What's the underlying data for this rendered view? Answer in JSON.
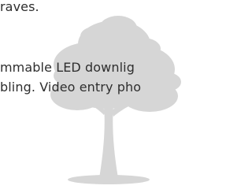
{
  "text": {
    "line_1": "raves.",
    "line_2": "mmable LED downlig",
    "line_3": "bling. Video entry pho"
  },
  "colors": {
    "text": "#2e2e2e",
    "tree_watermark": "#d6d6d6",
    "background": "#ffffff"
  },
  "decoration": {
    "watermark_icon": "tree-icon"
  }
}
